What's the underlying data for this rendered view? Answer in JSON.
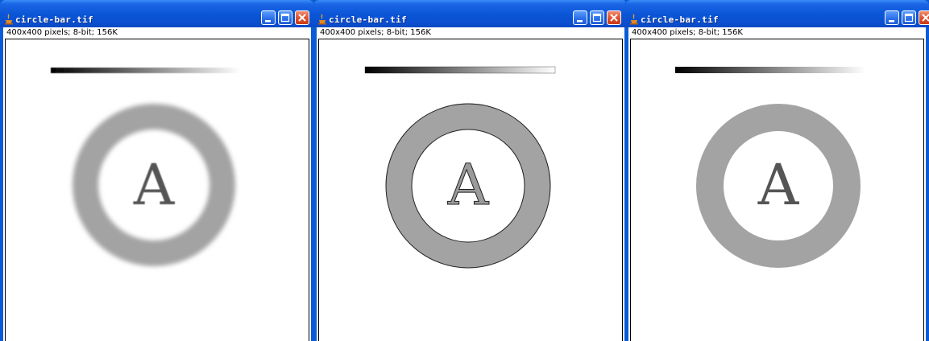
{
  "windows": [
    {
      "title": "circle-bar.tif",
      "info": "400x400 pixels; 8-bit; 156K",
      "image_letter": "A",
      "render": "blurred"
    },
    {
      "title": "circle-bar.tif",
      "info": "400x400 pixels; 8-bit; 156K",
      "image_letter": "A",
      "render": "edge-outlined"
    },
    {
      "title": "circle-bar.tif",
      "info": "400x400 pixels; 8-bit; 156K",
      "image_letter": "A",
      "render": "sharp"
    }
  ],
  "colors": {
    "ring_gray": "#a3a3a3",
    "letter_gray": "#555555",
    "titlebar_blue": "#0a55d6",
    "close_red": "#df4f2c"
  }
}
